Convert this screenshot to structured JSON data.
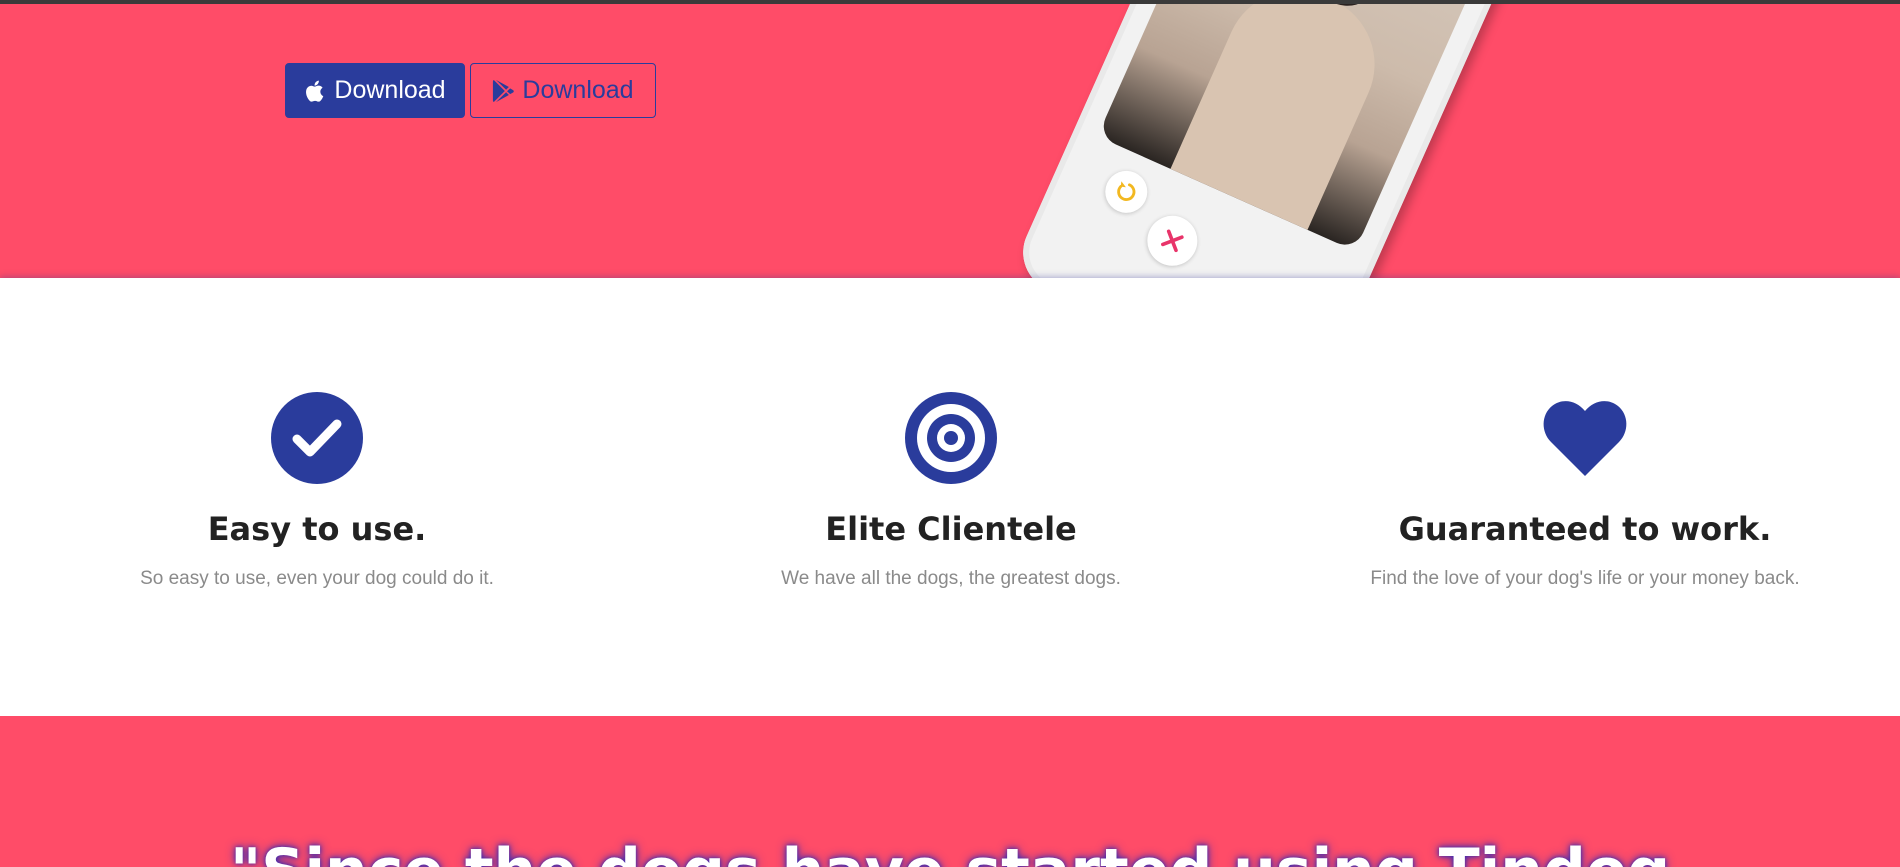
{
  "hero": {
    "buttons": {
      "ios_label": "Download",
      "play_label": "Download"
    }
  },
  "features": [
    {
      "icon": "check-circle-icon",
      "title": "Easy to use.",
      "text": "So easy to use, even your dog could do it."
    },
    {
      "icon": "bullseye-icon",
      "title": "Elite Clientele",
      "text": "We have all the dogs, the greatest dogs."
    },
    {
      "icon": "heart-icon",
      "title": "Guaranteed to work.",
      "text": "Find the love of your dog's life or your money back."
    }
  ],
  "testimonial": {
    "quote": "\"Since the dogs have started using Tindog"
  },
  "colors": {
    "brand_pink": "#ff4c68",
    "brand_blue": "#2a3c9c",
    "heading": "#222222",
    "muted": "#8a8a8a"
  }
}
